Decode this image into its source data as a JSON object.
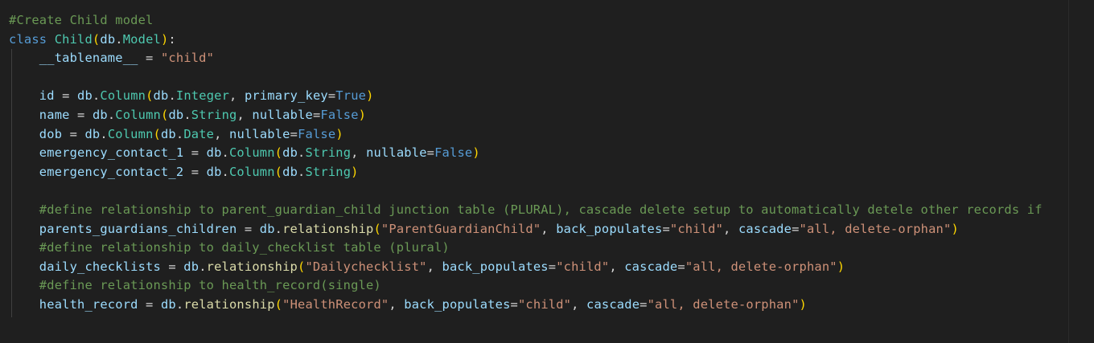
{
  "editor": {
    "lines": [
      [
        {
          "t": "#Create Child model",
          "c": "c"
        }
      ],
      [
        {
          "t": "class",
          "c": "k"
        },
        {
          "t": " ",
          "c": "p"
        },
        {
          "t": "Child",
          "c": "t"
        },
        {
          "t": "(",
          "c": "b1"
        },
        {
          "t": "db",
          "c": "v"
        },
        {
          "t": ".",
          "c": "p"
        },
        {
          "t": "Model",
          "c": "t"
        },
        {
          "t": ")",
          "c": "b1"
        },
        {
          "t": ":",
          "c": "p"
        }
      ],
      [
        {
          "t": "    ",
          "c": "p"
        },
        {
          "t": "__tablename__",
          "c": "v"
        },
        {
          "t": " = ",
          "c": "p"
        },
        {
          "t": "\"child\"",
          "c": "s"
        }
      ],
      [],
      [
        {
          "t": "    ",
          "c": "p"
        },
        {
          "t": "id",
          "c": "v"
        },
        {
          "t": " = ",
          "c": "p"
        },
        {
          "t": "db",
          "c": "v"
        },
        {
          "t": ".",
          "c": "p"
        },
        {
          "t": "Column",
          "c": "t"
        },
        {
          "t": "(",
          "c": "b1"
        },
        {
          "t": "db",
          "c": "v"
        },
        {
          "t": ".",
          "c": "p"
        },
        {
          "t": "Integer",
          "c": "t"
        },
        {
          "t": ", ",
          "c": "p"
        },
        {
          "t": "primary_key",
          "c": "v"
        },
        {
          "t": "=",
          "c": "p"
        },
        {
          "t": "True",
          "c": "k"
        },
        {
          "t": ")",
          "c": "b1"
        }
      ],
      [
        {
          "t": "    ",
          "c": "p"
        },
        {
          "t": "name",
          "c": "v"
        },
        {
          "t": " = ",
          "c": "p"
        },
        {
          "t": "db",
          "c": "v"
        },
        {
          "t": ".",
          "c": "p"
        },
        {
          "t": "Column",
          "c": "t"
        },
        {
          "t": "(",
          "c": "b1"
        },
        {
          "t": "db",
          "c": "v"
        },
        {
          "t": ".",
          "c": "p"
        },
        {
          "t": "String",
          "c": "t"
        },
        {
          "t": ", ",
          "c": "p"
        },
        {
          "t": "nullable",
          "c": "v"
        },
        {
          "t": "=",
          "c": "p"
        },
        {
          "t": "False",
          "c": "k"
        },
        {
          "t": ")",
          "c": "b1"
        }
      ],
      [
        {
          "t": "    ",
          "c": "p"
        },
        {
          "t": "dob",
          "c": "v"
        },
        {
          "t": " = ",
          "c": "p"
        },
        {
          "t": "db",
          "c": "v"
        },
        {
          "t": ".",
          "c": "p"
        },
        {
          "t": "Column",
          "c": "t"
        },
        {
          "t": "(",
          "c": "b1"
        },
        {
          "t": "db",
          "c": "v"
        },
        {
          "t": ".",
          "c": "p"
        },
        {
          "t": "Date",
          "c": "t"
        },
        {
          "t": ", ",
          "c": "p"
        },
        {
          "t": "nullable",
          "c": "v"
        },
        {
          "t": "=",
          "c": "p"
        },
        {
          "t": "False",
          "c": "k"
        },
        {
          "t": ")",
          "c": "b1"
        }
      ],
      [
        {
          "t": "    ",
          "c": "p"
        },
        {
          "t": "emergency_contact_1",
          "c": "v"
        },
        {
          "t": " = ",
          "c": "p"
        },
        {
          "t": "db",
          "c": "v"
        },
        {
          "t": ".",
          "c": "p"
        },
        {
          "t": "Column",
          "c": "t"
        },
        {
          "t": "(",
          "c": "b1"
        },
        {
          "t": "db",
          "c": "v"
        },
        {
          "t": ".",
          "c": "p"
        },
        {
          "t": "String",
          "c": "t"
        },
        {
          "t": ", ",
          "c": "p"
        },
        {
          "t": "nullable",
          "c": "v"
        },
        {
          "t": "=",
          "c": "p"
        },
        {
          "t": "False",
          "c": "k"
        },
        {
          "t": ")",
          "c": "b1"
        }
      ],
      [
        {
          "t": "    ",
          "c": "p"
        },
        {
          "t": "emergency_contact_2",
          "c": "v"
        },
        {
          "t": " = ",
          "c": "p"
        },
        {
          "t": "db",
          "c": "v"
        },
        {
          "t": ".",
          "c": "p"
        },
        {
          "t": "Column",
          "c": "t"
        },
        {
          "t": "(",
          "c": "b1"
        },
        {
          "t": "db",
          "c": "v"
        },
        {
          "t": ".",
          "c": "p"
        },
        {
          "t": "String",
          "c": "t"
        },
        {
          "t": ")",
          "c": "b1"
        }
      ],
      [],
      [
        {
          "t": "    ",
          "c": "p"
        },
        {
          "t": "#define relationship to parent_guardian_child junction table (PLURAL), cascade delete setup to automatically detele other records if",
          "c": "c"
        }
      ],
      [
        {
          "t": "    ",
          "c": "p"
        },
        {
          "t": "parents_guardians_children",
          "c": "v"
        },
        {
          "t": " = ",
          "c": "p"
        },
        {
          "t": "db",
          "c": "v"
        },
        {
          "t": ".",
          "c": "p"
        },
        {
          "t": "relationship",
          "c": "f"
        },
        {
          "t": "(",
          "c": "b1"
        },
        {
          "t": "\"ParentGuardianChild\"",
          "c": "s"
        },
        {
          "t": ", ",
          "c": "p"
        },
        {
          "t": "back_populates",
          "c": "v"
        },
        {
          "t": "=",
          "c": "p"
        },
        {
          "t": "\"child\"",
          "c": "s"
        },
        {
          "t": ", ",
          "c": "p"
        },
        {
          "t": "cascade",
          "c": "v"
        },
        {
          "t": "=",
          "c": "p"
        },
        {
          "t": "\"all, delete-orphan\"",
          "c": "s"
        },
        {
          "t": ")",
          "c": "b1"
        }
      ],
      [
        {
          "t": "    ",
          "c": "p"
        },
        {
          "t": "#define relationship to daily_checklist table (plural)",
          "c": "c"
        }
      ],
      [
        {
          "t": "    ",
          "c": "p"
        },
        {
          "t": "daily_checklists",
          "c": "v"
        },
        {
          "t": " = ",
          "c": "p"
        },
        {
          "t": "db",
          "c": "v"
        },
        {
          "t": ".",
          "c": "p"
        },
        {
          "t": "relationship",
          "c": "f"
        },
        {
          "t": "(",
          "c": "b1"
        },
        {
          "t": "\"Dailychecklist\"",
          "c": "s"
        },
        {
          "t": ", ",
          "c": "p"
        },
        {
          "t": "back_populates",
          "c": "v"
        },
        {
          "t": "=",
          "c": "p"
        },
        {
          "t": "\"child\"",
          "c": "s"
        },
        {
          "t": ", ",
          "c": "p"
        },
        {
          "t": "cascade",
          "c": "v"
        },
        {
          "t": "=",
          "c": "p"
        },
        {
          "t": "\"all, delete-orphan\"",
          "c": "s"
        },
        {
          "t": ")",
          "c": "b1"
        }
      ],
      [
        {
          "t": "    ",
          "c": "p"
        },
        {
          "t": "#define relationship to health_record(single)",
          "c": "c"
        }
      ],
      [
        {
          "t": "    ",
          "c": "p"
        },
        {
          "t": "health_record",
          "c": "v"
        },
        {
          "t": " = ",
          "c": "p"
        },
        {
          "t": "db",
          "c": "v"
        },
        {
          "t": ".",
          "c": "p"
        },
        {
          "t": "relationship",
          "c": "f"
        },
        {
          "t": "(",
          "c": "b1"
        },
        {
          "t": "\"HealthRecord\"",
          "c": "s"
        },
        {
          "t": ", ",
          "c": "p"
        },
        {
          "t": "back_populates",
          "c": "v"
        },
        {
          "t": "=",
          "c": "p"
        },
        {
          "t": "\"child\"",
          "c": "s"
        },
        {
          "t": ", ",
          "c": "p"
        },
        {
          "t": "cascade",
          "c": "v"
        },
        {
          "t": "=",
          "c": "p"
        },
        {
          "t": "\"all, delete-orphan\"",
          "c": "s"
        },
        {
          "t": ")",
          "c": "b1"
        }
      ]
    ]
  },
  "colors": {
    "background": "#1f1f1f",
    "comment": "#6a9955",
    "keyword": "#569cd6",
    "class_name": "#4ec9b0",
    "variable": "#9cdcfe",
    "function": "#dcdcaa",
    "string": "#ce9178",
    "bracket": "#ffd700"
  }
}
